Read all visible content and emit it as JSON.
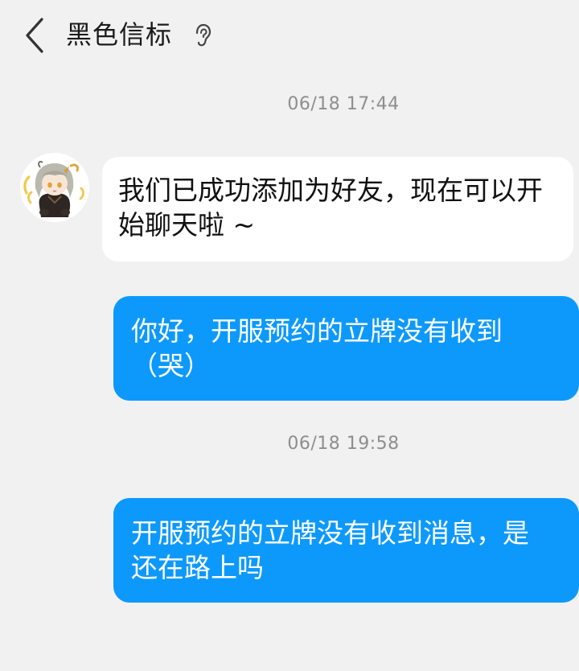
{
  "header": {
    "back_icon": "chevron-left-icon",
    "title": "黑色信标",
    "status_icon": "ear-icon"
  },
  "messages": [
    {
      "timestamp": "06/18 17:44",
      "sender": "contact",
      "text": "我们已成功添加为好友，现在可以开始聊天啦 ~"
    },
    {
      "sender": "self",
      "text": "你好，开服预约的立牌没有收到（哭）"
    },
    {
      "timestamp": "06/18 19:58",
      "sender": "self",
      "text": "开服预约的立牌没有收到消息，是还在路上吗"
    }
  ],
  "colors": {
    "background": "#f1f1f1",
    "incoming_bubble": "#ffffff",
    "outgoing_bubble": "#0d99fb",
    "timestamp": "#8e8e8e"
  }
}
